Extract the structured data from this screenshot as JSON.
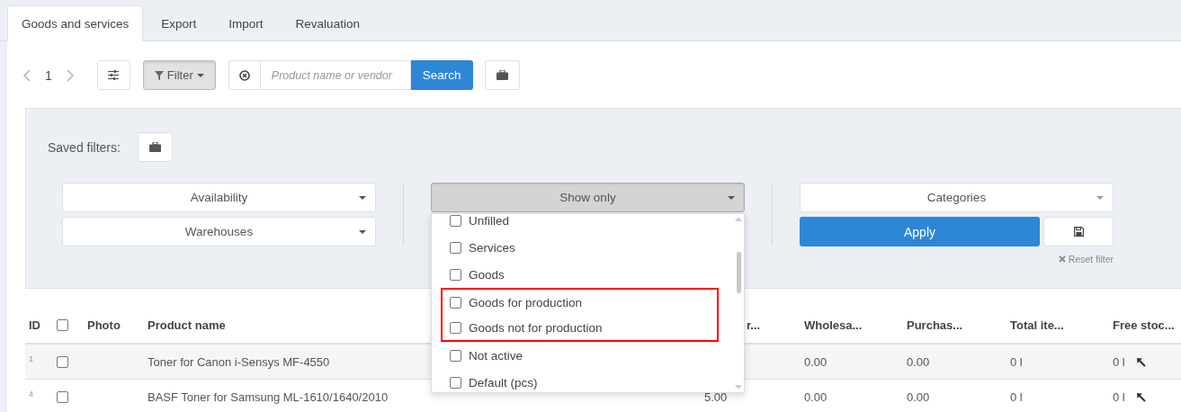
{
  "tabs": [
    {
      "label": "Goods and services",
      "selected": true
    },
    {
      "label": "Export",
      "selected": false
    },
    {
      "label": "Import",
      "selected": false
    },
    {
      "label": "Revaluation",
      "selected": false
    }
  ],
  "toolbar": {
    "page": "1",
    "filter_button": "Filter",
    "filter_open": true,
    "search_placeholder": "Product name or vendor",
    "search_button": "Search"
  },
  "filter_panel": {
    "saved_filters_label": "Saved filters:",
    "left_selects": [
      "Availability",
      "Warehouses"
    ],
    "show_only": {
      "label": "Show only",
      "expanded": true,
      "options": [
        {
          "label": "Unfilled",
          "checked": false,
          "highlighted": false
        },
        {
          "label": "Services",
          "checked": false,
          "highlighted": false
        },
        {
          "label": "Goods",
          "checked": false,
          "highlighted": false
        },
        {
          "label": "Goods for production",
          "checked": false,
          "highlighted": true
        },
        {
          "label": "Goods not for production",
          "checked": false,
          "highlighted": true
        },
        {
          "label": "Not active",
          "checked": false,
          "highlighted": false
        },
        {
          "label": "Default (pcs)",
          "checked": false,
          "highlighted": false
        }
      ]
    },
    "categories_select": "Categories",
    "apply_button": "Apply",
    "reset_link": "Reset filter"
  },
  "table": {
    "columns": [
      {
        "kind": "text",
        "label": "ID"
      },
      {
        "kind": "checkbox",
        "checked": false
      },
      {
        "kind": "text",
        "label": "Photo"
      },
      {
        "kind": "text",
        "label": "Product name"
      },
      {
        "kind": "partial",
        "label": "r..."
      },
      {
        "kind": "text",
        "label": "Wholesa..."
      },
      {
        "kind": "text",
        "label": "Purchas..."
      },
      {
        "kind": "text",
        "label": "Total ite..."
      },
      {
        "kind": "text",
        "label": "Free stoc..."
      }
    ],
    "rows": [
      {
        "id": "1",
        "checked": false,
        "product_name": "Toner for Canon i-Sensys MF-4550",
        "wholesale": "0.00",
        "purchase": "0.00",
        "total_items": "0 l",
        "free_stock": "0 l"
      },
      {
        "id": "4",
        "checked": false,
        "product_name": "BASF Toner for Samsung ML-1610/1640/2010",
        "column_5": "5.00",
        "wholesale": "0.00",
        "purchase": "0.00",
        "total_items": "0 l",
        "free_stock": "0 l"
      }
    ]
  }
}
